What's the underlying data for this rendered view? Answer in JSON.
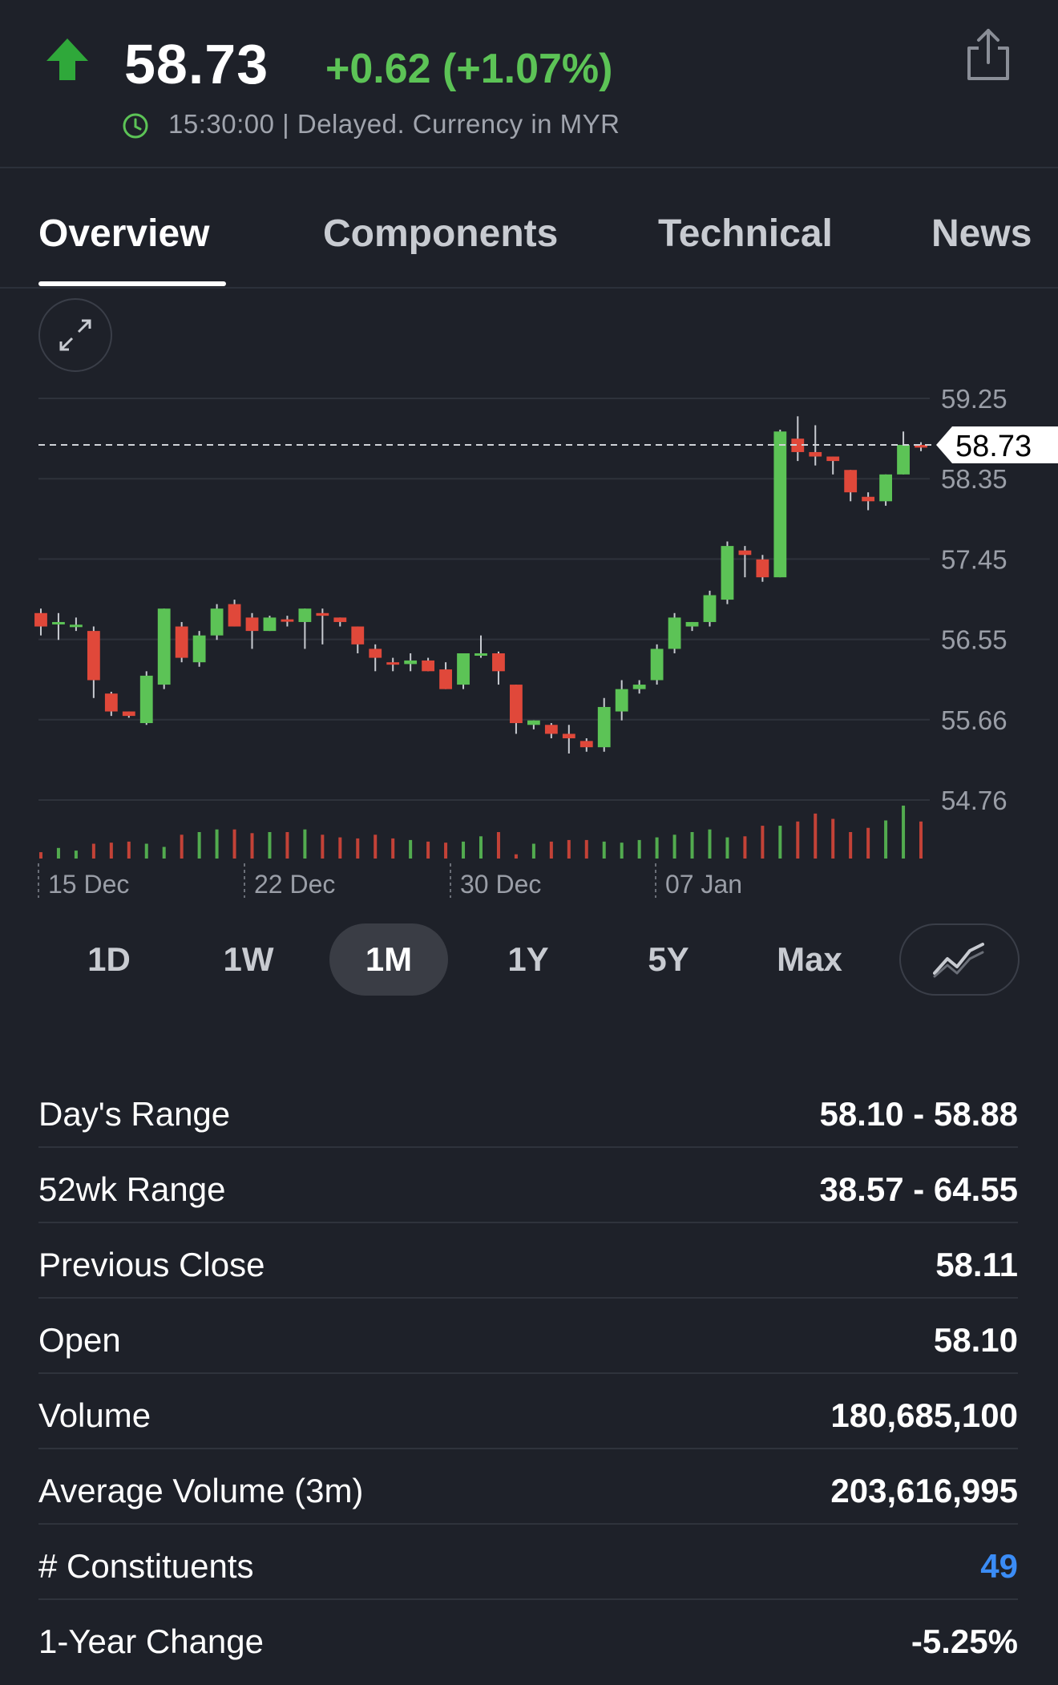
{
  "quote": {
    "price": "58.73",
    "change": "+0.62 (+1.07%)",
    "status": "15:30:00 | Delayed. Currency in MYR",
    "accent_up": "#5cc356",
    "accent_down": "#e0483a"
  },
  "tabs": [
    {
      "label": "Overview",
      "active": true
    },
    {
      "label": "Components",
      "active": false
    },
    {
      "label": "Technical",
      "active": false
    },
    {
      "label": "News",
      "active": false
    }
  ],
  "chart_data": {
    "type": "candlestick",
    "y_ticks": [
      "59.25",
      "58.35",
      "57.45",
      "56.55",
      "55.66",
      "54.76"
    ],
    "ylim": [
      54.76,
      59.25
    ],
    "current_price": "58.73",
    "x_labels": [
      "15 Dec",
      "22 Dec",
      "30 Dec",
      "07 Jan"
    ],
    "candles": [
      {
        "o": 56.85,
        "h": 56.9,
        "l": 56.6,
        "c": 56.7
      },
      {
        "o": 56.75,
        "h": 56.85,
        "l": 56.55,
        "c": 56.75
      },
      {
        "o": 56.72,
        "h": 56.8,
        "l": 56.65,
        "c": 56.72
      },
      {
        "o": 56.65,
        "h": 56.7,
        "l": 55.9,
        "c": 56.1
      },
      {
        "o": 55.95,
        "h": 55.97,
        "l": 55.7,
        "c": 55.75
      },
      {
        "o": 55.75,
        "h": 55.75,
        "l": 55.68,
        "c": 55.7
      },
      {
        "o": 55.62,
        "h": 56.2,
        "l": 55.6,
        "c": 56.15
      },
      {
        "o": 56.05,
        "h": 56.9,
        "l": 56.0,
        "c": 56.9
      },
      {
        "o": 56.7,
        "h": 56.75,
        "l": 56.3,
        "c": 56.35
      },
      {
        "o": 56.3,
        "h": 56.65,
        "l": 56.25,
        "c": 56.6
      },
      {
        "o": 56.6,
        "h": 56.95,
        "l": 56.55,
        "c": 56.9
      },
      {
        "o": 56.95,
        "h": 57.0,
        "l": 56.7,
        "c": 56.7
      },
      {
        "o": 56.8,
        "h": 56.85,
        "l": 56.45,
        "c": 56.65
      },
      {
        "o": 56.65,
        "h": 56.82,
        "l": 56.65,
        "c": 56.8
      },
      {
        "o": 56.78,
        "h": 56.82,
        "l": 56.7,
        "c": 56.76
      },
      {
        "o": 56.75,
        "h": 56.9,
        "l": 56.45,
        "c": 56.9
      },
      {
        "o": 56.85,
        "h": 56.9,
        "l": 56.5,
        "c": 56.82
      },
      {
        "o": 56.8,
        "h": 56.8,
        "l": 56.7,
        "c": 56.75
      },
      {
        "o": 56.7,
        "h": 56.7,
        "l": 56.4,
        "c": 56.5
      },
      {
        "o": 56.45,
        "h": 56.5,
        "l": 56.2,
        "c": 56.35
      },
      {
        "o": 56.3,
        "h": 56.35,
        "l": 56.2,
        "c": 56.28
      },
      {
        "o": 56.28,
        "h": 56.4,
        "l": 56.2,
        "c": 56.32
      },
      {
        "o": 56.32,
        "h": 56.35,
        "l": 56.2,
        "c": 56.2
      },
      {
        "o": 56.22,
        "h": 56.3,
        "l": 56.0,
        "c": 56.0
      },
      {
        "o": 56.05,
        "h": 56.4,
        "l": 56.0,
        "c": 56.4
      },
      {
        "o": 56.4,
        "h": 56.6,
        "l": 56.35,
        "c": 56.4
      },
      {
        "o": 56.4,
        "h": 56.42,
        "l": 56.05,
        "c": 56.2
      },
      {
        "o": 56.05,
        "h": 56.05,
        "l": 55.5,
        "c": 55.62
      },
      {
        "o": 55.6,
        "h": 55.65,
        "l": 55.55,
        "c": 55.65
      },
      {
        "o": 55.6,
        "h": 55.62,
        "l": 55.45,
        "c": 55.5
      },
      {
        "o": 55.5,
        "h": 55.6,
        "l": 55.28,
        "c": 55.45
      },
      {
        "o": 55.42,
        "h": 55.45,
        "l": 55.3,
        "c": 55.35
      },
      {
        "o": 55.35,
        "h": 55.9,
        "l": 55.3,
        "c": 55.8
      },
      {
        "o": 55.75,
        "h": 56.1,
        "l": 55.65,
        "c": 56.0
      },
      {
        "o": 56.0,
        "h": 56.1,
        "l": 55.95,
        "c": 56.05
      },
      {
        "o": 56.1,
        "h": 56.5,
        "l": 56.05,
        "c": 56.45
      },
      {
        "o": 56.45,
        "h": 56.85,
        "l": 56.4,
        "c": 56.8
      },
      {
        "o": 56.7,
        "h": 56.75,
        "l": 56.65,
        "c": 56.75
      },
      {
        "o": 56.75,
        "h": 57.1,
        "l": 56.7,
        "c": 57.05
      },
      {
        "o": 57.0,
        "h": 57.65,
        "l": 56.95,
        "c": 57.6
      },
      {
        "o": 57.55,
        "h": 57.6,
        "l": 57.25,
        "c": 57.5
      },
      {
        "o": 57.45,
        "h": 57.5,
        "l": 57.2,
        "c": 57.25
      },
      {
        "o": 57.25,
        "h": 58.9,
        "l": 57.25,
        "c": 58.88
      },
      {
        "o": 58.8,
        "h": 59.05,
        "l": 58.55,
        "c": 58.65
      },
      {
        "o": 58.65,
        "h": 58.95,
        "l": 58.5,
        "c": 58.6
      },
      {
        "o": 58.6,
        "h": 58.6,
        "l": 58.4,
        "c": 58.55
      },
      {
        "o": 58.45,
        "h": 58.45,
        "l": 58.1,
        "c": 58.2
      },
      {
        "o": 58.15,
        "h": 58.2,
        "l": 58.0,
        "c": 58.1
      },
      {
        "o": 58.1,
        "h": 58.4,
        "l": 58.05,
        "c": 58.4
      },
      {
        "o": 58.4,
        "h": 58.88,
        "l": 58.4,
        "c": 58.73
      },
      {
        "o": 58.73,
        "h": 58.76,
        "l": 58.66,
        "c": 58.7
      }
    ],
    "volumes": [
      0.12,
      0.2,
      0.15,
      0.28,
      0.3,
      0.32,
      0.28,
      0.22,
      0.45,
      0.5,
      0.55,
      0.55,
      0.48,
      0.5,
      0.5,
      0.55,
      0.45,
      0.4,
      0.38,
      0.45,
      0.38,
      0.35,
      0.32,
      0.3,
      0.32,
      0.42,
      0.5,
      0.08,
      0.28,
      0.32,
      0.35,
      0.35,
      0.32,
      0.3,
      0.35,
      0.4,
      0.45,
      0.5,
      0.55,
      0.4,
      0.42,
      0.62,
      0.62,
      0.7,
      0.85,
      0.75,
      0.5,
      0.58,
      0.72,
      1.0,
      0.7
    ]
  },
  "periods": [
    {
      "label": "1D",
      "active": false
    },
    {
      "label": "1W",
      "active": false
    },
    {
      "label": "1M",
      "active": true
    },
    {
      "label": "1Y",
      "active": false
    },
    {
      "label": "5Y",
      "active": false
    },
    {
      "label": "Max",
      "active": false
    }
  ],
  "stats": [
    {
      "label": "Day's Range",
      "value": "58.10 - 58.88"
    },
    {
      "label": "52wk Range",
      "value": "38.57 - 64.55"
    },
    {
      "label": "Previous Close",
      "value": "58.11"
    },
    {
      "label": "Open",
      "value": "58.10"
    },
    {
      "label": "Volume",
      "value": "180,685,100"
    },
    {
      "label": "Average Volume (3m)",
      "value": "203,616,995"
    },
    {
      "label": "# Constituents",
      "value": "49",
      "link": true
    },
    {
      "label": "1-Year Change",
      "value": "-5.25%"
    }
  ]
}
